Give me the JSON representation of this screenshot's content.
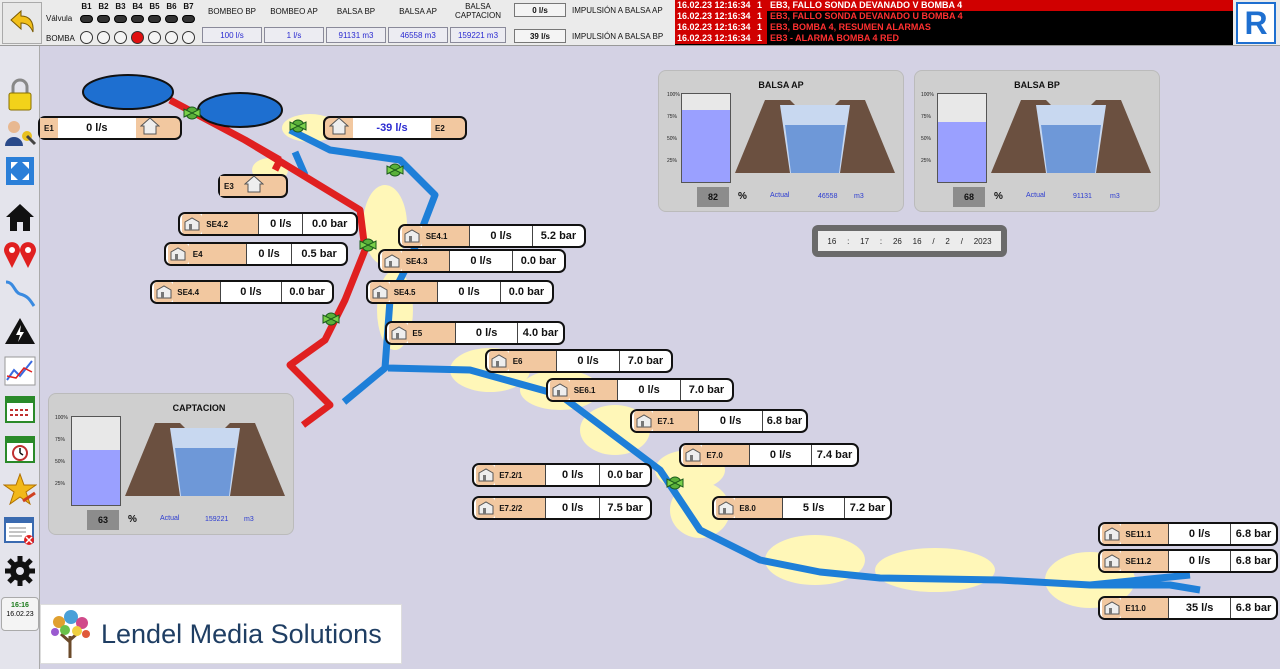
{
  "header": {
    "pumps": [
      "B1",
      "B2",
      "B3",
      "B4",
      "B5",
      "B6",
      "B7"
    ],
    "valve_label": "Válvula",
    "pump_label": "BOMBA",
    "pump_states": [
      false,
      false,
      false,
      true,
      false,
      false,
      false
    ],
    "columns": [
      {
        "title": "BOMBEO BP",
        "value": "100 l/s"
      },
      {
        "title": "BOMBEO AP",
        "value": "1 l/s"
      },
      {
        "title": "BALSA BP",
        "value": "91131 m3"
      },
      {
        "title": "BALSA AP",
        "value": "46558 m3"
      },
      {
        "title": "BALSA CAPTACION",
        "value": "159221 m3"
      }
    ],
    "impulsion": [
      {
        "value": "0 l/s",
        "label": "IMPULSIÓN A BALSA AP"
      },
      {
        "value": "39 l/s",
        "label": "IMPULSIÓN A BALSA BP"
      }
    ]
  },
  "alarms": [
    {
      "time": "16.02.23 12:16:34",
      "num": "1",
      "msg": "EB3, FALLO SONDA DEVANADO V BOMBA 4"
    },
    {
      "time": "16.02.23 12:16:34",
      "num": "1",
      "msg": "EB3, FALLO SONDA DEVANADO U BOMBA 4"
    },
    {
      "time": "16.02.23 12:16:34",
      "num": "1",
      "msg": "EB3, BOMBA 4, RESUMEN ALARMAS"
    },
    {
      "time": "16.02.23 12:16:34",
      "num": "1",
      "msg": "EB3 - ALARMA BOMBA 4 RED"
    }
  ],
  "r_button": "R",
  "sidebar": {
    "clock_time": "16:16",
    "clock_date": "16.02.23"
  },
  "tanks": [
    {
      "id": "E1",
      "flow": "0 l/s"
    },
    {
      "id": "E2",
      "flow": "-39 l/s"
    },
    {
      "id": "E3"
    }
  ],
  "stations": [
    {
      "id": "SE4.2",
      "flow": "0 l/s",
      "pressure": "0.0 bar"
    },
    {
      "id": "E4",
      "flow": "0 l/s",
      "pressure": "0.5 bar"
    },
    {
      "id": "SE4.4",
      "flow": "0 l/s",
      "pressure": "0.0 bar"
    },
    {
      "id": "SE4.1",
      "flow": "0 l/s",
      "pressure": "5.2 bar"
    },
    {
      "id": "SE4.3",
      "flow": "0 l/s",
      "pressure": "0.0 bar"
    },
    {
      "id": "SE4.5",
      "flow": "0 l/s",
      "pressure": "0.0 bar"
    },
    {
      "id": "E5",
      "flow": "0 l/s",
      "pressure": "4.0 bar"
    },
    {
      "id": "E6",
      "flow": "0 l/s",
      "pressure": "7.0 bar"
    },
    {
      "id": "SE6.1",
      "flow": "0 l/s",
      "pressure": "7.0 bar"
    },
    {
      "id": "E7.1",
      "flow": "0 l/s",
      "pressure": "6.8 bar"
    },
    {
      "id": "E7.0",
      "flow": "0 l/s",
      "pressure": "7.4 bar"
    },
    {
      "id": "E7.2/1",
      "flow": "0 l/s",
      "pressure": "0.0 bar"
    },
    {
      "id": "E7.2/2",
      "flow": "0 l/s",
      "pressure": "7.5 bar"
    },
    {
      "id": "E8.0",
      "flow": "5 l/s",
      "pressure": "7.2 bar"
    },
    {
      "id": "SE11.1",
      "flow": "0 l/s",
      "pressure": "6.8 bar"
    },
    {
      "id": "SE11.2",
      "flow": "0 l/s",
      "pressure": "6.8 bar"
    },
    {
      "id": "E11.0",
      "flow": "35 l/s",
      "pressure": "6.8 bar"
    }
  ],
  "reservoirs": {
    "ap": {
      "title": "BALSA AP",
      "percent": "82",
      "level": 0.82,
      "actual_label": "Actual",
      "value": "46558",
      "unit": "m3"
    },
    "bp": {
      "title": "BALSA BP",
      "percent": "68",
      "level": 0.68,
      "actual_label": "Actual",
      "value": "91131",
      "unit": "m3"
    },
    "captacion": {
      "title": "CAPTACION",
      "percent": "63",
      "level": 0.63,
      "actual_label": "Actual",
      "value": "159221",
      "unit": "m3"
    }
  },
  "gauge_ticks": [
    "100%",
    "75%",
    "50%",
    "25%"
  ],
  "pct_symbol": "%",
  "datetime": {
    "day": "16",
    "sep1": ":",
    "min": "17",
    "sep2": ":",
    "sec": "26",
    "d": "16",
    "s3": "/",
    "m": "2",
    "s4": "/",
    "y": "2023"
  },
  "logo": {
    "text": "Lendel Media Solutions"
  },
  "colors": {
    "pipe_red": "#e02020",
    "pipe_blue": "#1e7fd8",
    "tank_blue": "#1e6fd0",
    "highlight": "#fff7b8"
  }
}
